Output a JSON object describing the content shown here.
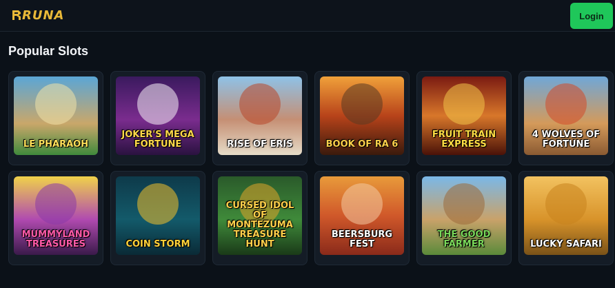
{
  "header": {
    "logo_text": "RUNA",
    "logo_color": "#e8b838",
    "login_label": "Login",
    "login_color": "#1fc75a"
  },
  "section": {
    "title": "Popular Slots"
  },
  "games": [
    {
      "title": "Le Pharaoh",
      "bg": "linear-gradient(180deg,#5aa6d6 0%,#c9a76a 60%,#3f8a3c 100%)",
      "art": "#f1e2a8",
      "text": "#ffe15a"
    },
    {
      "title": "Joker's Mega Fortune",
      "bg": "linear-gradient(180deg,#3a1a5e 0%,#7a2c8e 55%,#2a1240 100%)",
      "art": "#f6f0f6",
      "text": "#ffd84a"
    },
    {
      "title": "Rise of Eris",
      "bg": "linear-gradient(180deg,#8ec2e8 0%,#c58f74 55%,#e6dcc8 100%)",
      "art": "#b8472a",
      "text": "#ffffff"
    },
    {
      "title": "Book of Ra 6",
      "bg": "linear-gradient(180deg,#f0a13a 0%,#b8431a 50%,#3a1a0c 100%)",
      "art": "#5a3a22",
      "text": "#ffd04a"
    },
    {
      "title": "Fruit Train Express",
      "bg": "linear-gradient(180deg,#7a1a12 0%,#d8772a 50%,#4a1208 100%)",
      "art": "#f0c248",
      "text": "#ffdd44"
    },
    {
      "title": "4 Wolves of Fortune",
      "bg": "linear-gradient(180deg,#6fa7d8 0%,#d49a5a 60%,#8a5a32 100%)",
      "art": "#d24a2a",
      "text": "#ffffff"
    },
    {
      "title": "Mummyland Treasures",
      "bg": "linear-gradient(180deg,#f0d24a 0%,#b04ab0 55%,#3a1a4a 100%)",
      "art": "#8a3aa6",
      "text": "#ff5aa8"
    },
    {
      "title": "Coin Storm",
      "bg": "linear-gradient(180deg,#0e3a4a 0%,#135a6a 55%,#0a2a36 100%)",
      "art": "#f2c02a",
      "text": "#ffd23a"
    },
    {
      "title": "Cursed Idol of Montezuma Treasure Hunt",
      "bg": "linear-gradient(180deg,#2a5a2a 0%,#3f8a3a 55%,#1a3a18 100%)",
      "art": "#e0a42a",
      "text": "#ffd04a"
    },
    {
      "title": "Beersburg Fest",
      "bg": "linear-gradient(180deg,#e89a3a 0%,#d0582a 50%,#8a2a1a 100%)",
      "art": "#f2c8a0",
      "text": "#ffffff"
    },
    {
      "title": "The Good Farmer",
      "bg": "linear-gradient(180deg,#7ab8e8 0%,#c9a26a 55%,#5a8a3a 100%)",
      "art": "#9a6a3a",
      "text": "#7ad85a"
    },
    {
      "title": "Lucky Safari",
      "bg": "linear-gradient(180deg,#f2c260 0%,#d8932a 55%,#7a5218 100%)",
      "art": "#c8841e",
      "text": "#ffffff"
    }
  ]
}
